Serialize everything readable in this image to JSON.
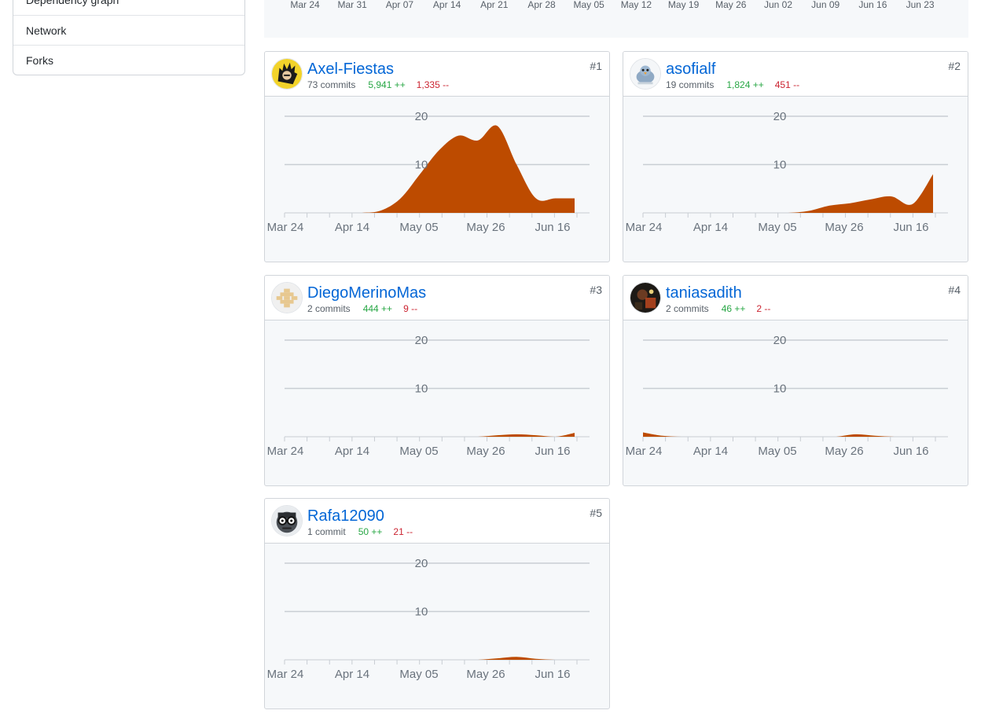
{
  "sidebar": {
    "items": [
      {
        "label": "Dependency graph"
      },
      {
        "label": "Network"
      },
      {
        "label": "Forks"
      }
    ]
  },
  "timeline": {
    "ticks": [
      "Mar 24",
      "Mar 31",
      "Apr 07",
      "Apr 14",
      "Apr 21",
      "Apr 28",
      "May 05",
      "May 12",
      "May 19",
      "May 26",
      "Jun 02",
      "Jun 09",
      "Jun 16",
      "Jun 23"
    ]
  },
  "colors": {
    "area": "#bd4b00",
    "grid": "#c8cdd3",
    "link": "#0366d6",
    "additions": "#28a745",
    "deletions": "#cb2431"
  },
  "contributors": [
    {
      "rank": "#1",
      "login": "Axel-Fiestas",
      "commits": "73 commits",
      "additions": "5,941 ++",
      "deletions": "1,335 --",
      "avatar_icon": "spiky-hair-avatar-icon"
    },
    {
      "rank": "#2",
      "login": "asofialf",
      "commits": "19 commits",
      "additions": "1,824 ++",
      "deletions": "451 --",
      "avatar_icon": "bird-avatar-icon"
    },
    {
      "rank": "#3",
      "login": "DiegoMerinoMas",
      "commits": "2 commits",
      "additions": "444 ++",
      "deletions": "9 --",
      "avatar_icon": "identicon-avatar-icon"
    },
    {
      "rank": "#4",
      "login": "taniasadith",
      "commits": "2 commits",
      "additions": "46 ++",
      "deletions": "2 --",
      "avatar_icon": "photo-avatar-icon"
    },
    {
      "rank": "#5",
      "login": "Rafa12090",
      "commits": "1 commit",
      "additions": "50 ++",
      "deletions": "21 --",
      "avatar_icon": "glasses-avatar-icon"
    }
  ],
  "chart_data": [
    {
      "type": "area",
      "series": [
        {
          "name": "Axel-Fiestas",
          "values": [
            0,
            0,
            0,
            0,
            0,
            0.5,
            3,
            8,
            13,
            16,
            15,
            18,
            10,
            3,
            3,
            3
          ]
        }
      ],
      "x": [
        "Mar 24",
        "Mar 31",
        "Apr 07",
        "Apr 14",
        "Apr 21",
        "Apr 28",
        "May 05",
        "May 12",
        "May 19",
        "May 26",
        "Jun 02",
        "Jun 09",
        "Jun 16",
        "Jun 23"
      ],
      "x_tick_labels": [
        "Mar 24",
        "Apr 14",
        "May 05",
        "May 26",
        "Jun 16"
      ],
      "y_ticks": [
        10,
        20
      ],
      "ylim": [
        0,
        20
      ],
      "grid": true
    },
    {
      "type": "area",
      "series": [
        {
          "name": "asofialf",
          "values": [
            0,
            0,
            0,
            0,
            0,
            0,
            0,
            0,
            0.4,
            1.5,
            2,
            2.8,
            3.4,
            1.8,
            8
          ]
        }
      ],
      "x_tick_labels": [
        "Mar 24",
        "Apr 14",
        "May 05",
        "May 26",
        "Jun 16"
      ],
      "y_ticks": [
        10,
        20
      ],
      "ylim": [
        0,
        20
      ],
      "grid": true
    },
    {
      "type": "area",
      "series": [
        {
          "name": "DiegoMerinoMas",
          "values": [
            0,
            0,
            0,
            0,
            0,
            0,
            0,
            0,
            0,
            0,
            0,
            0.3,
            0.5,
            0.3,
            0,
            0.8
          ]
        }
      ],
      "x_tick_labels": [
        "Mar 24",
        "Apr 14",
        "May 05",
        "May 26",
        "Jun 16"
      ],
      "y_ticks": [
        10,
        20
      ],
      "ylim": [
        0,
        20
      ],
      "grid": true
    },
    {
      "type": "area",
      "series": [
        {
          "name": "taniasadith",
          "values": [
            0.9,
            0.2,
            0,
            0,
            0,
            0,
            0,
            0,
            0,
            0,
            0,
            0.5,
            0.2,
            0,
            0,
            0
          ]
        }
      ],
      "x_tick_labels": [
        "Mar 24",
        "Apr 14",
        "May 05",
        "May 26",
        "Jun 16"
      ],
      "y_ticks": [
        10,
        20
      ],
      "ylim": [
        0,
        20
      ],
      "grid": true
    },
    {
      "type": "area",
      "series": [
        {
          "name": "Rafa12090",
          "values": [
            0,
            0,
            0,
            0,
            0,
            0,
            0,
            0,
            0,
            0,
            0,
            0.3,
            0.6,
            0.2,
            0,
            0
          ]
        }
      ],
      "x_tick_labels": [
        "Mar 24",
        "Apr 14",
        "May 05",
        "May 26",
        "Jun 16"
      ],
      "y_ticks": [
        10,
        20
      ],
      "ylim": [
        0,
        20
      ],
      "grid": true
    }
  ]
}
